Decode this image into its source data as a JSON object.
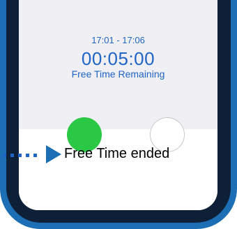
{
  "timer": {
    "time_range": "17:01 - 17:06",
    "countdown": "00:05:00",
    "remaining_label": "Free Time Remaining"
  },
  "callout": {
    "label": "Free Time ended"
  },
  "colors": {
    "frame_blue": "#1c6fb4",
    "text_blue": "#1f65c5",
    "green_button": "#2ac845",
    "panel_gray": "#efeff4"
  },
  "icons": [
    "arrow-right-icon"
  ]
}
